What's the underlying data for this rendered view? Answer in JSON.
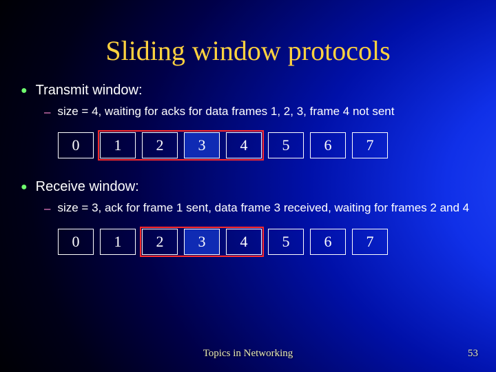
{
  "title": "Sliding window protocols",
  "bullets": {
    "transmit": {
      "heading": "Transmit window:",
      "sub": "size = 4, waiting for acks for data frames 1, 2, 3, frame 4 not sent"
    },
    "receive": {
      "heading": "Receive window:",
      "sub": "size = 3, ack for frame 1 sent, data frame 3 received, waiting for frames 2 and 4"
    }
  },
  "rows": {
    "transmit": {
      "cells": [
        "0",
        "1",
        "2",
        "3",
        "4",
        "5",
        "6",
        "7"
      ],
      "filled": [
        3
      ],
      "highlight": {
        "startIndex": 1,
        "span": 4
      }
    },
    "receive": {
      "cells": [
        "0",
        "1",
        "2",
        "3",
        "4",
        "5",
        "6",
        "7"
      ],
      "filled": [
        3
      ],
      "highlight": {
        "startIndex": 2,
        "span": 3
      }
    }
  },
  "footer": "Topics in Networking",
  "page": "53",
  "chart_data": {
    "type": "table",
    "description": "Sliding window protocol state: two sequence-number rows 0–7 with highlighted window regions.",
    "transmit_window": {
      "sequence_numbers": [
        0,
        1,
        2,
        3,
        4,
        5,
        6,
        7
      ],
      "window_size": 4,
      "window_range": [
        1,
        4
      ],
      "sent_frames": [
        1,
        2,
        3
      ],
      "data_filled_frame": 3,
      "note": "frame 4 not sent"
    },
    "receive_window": {
      "sequence_numbers": [
        0,
        1,
        2,
        3,
        4,
        5,
        6,
        7
      ],
      "window_size": 3,
      "window_range": [
        2,
        4
      ],
      "ack_sent_for": 1,
      "received_frames": [
        3
      ],
      "waiting_for": [
        2,
        4
      ]
    }
  }
}
